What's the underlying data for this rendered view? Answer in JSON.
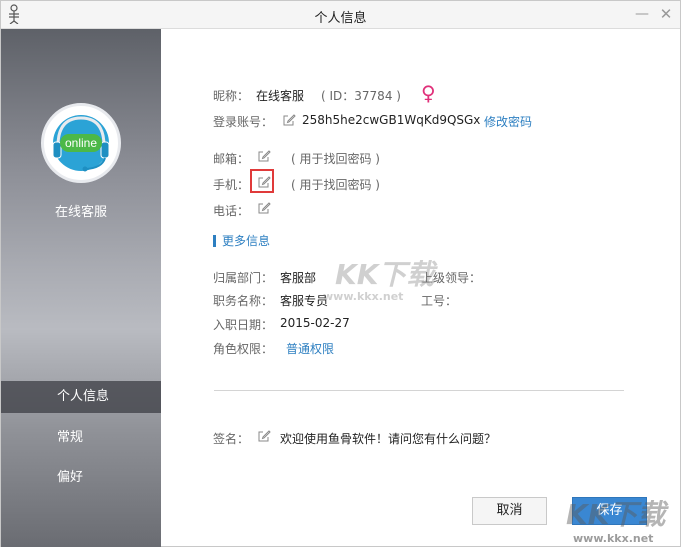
{
  "window": {
    "title": "个人信息"
  },
  "titlebar": {
    "minimize_glyph": "—",
    "close_glyph": "✕"
  },
  "sidebar": {
    "avatar_text": "online",
    "username": "在线客服",
    "items": [
      {
        "label": "个人信息",
        "active": true
      },
      {
        "label": "常规",
        "active": false
      },
      {
        "label": "偏好",
        "active": false
      }
    ]
  },
  "profile": {
    "nickname_label": "昵称：",
    "nickname_value": "在线客服",
    "id_text": "( ID：37784 )",
    "gender_icon": "female-symbol-icon",
    "gender_glyph": "♀",
    "gender_color": "#e0307a",
    "account_label": "登录账号：",
    "account_value": "258h5he2cwGB1WqKd9QSGx",
    "change_password_link": "修改密码",
    "email_label": "邮箱：",
    "email_hint": "( 用于找回密码 )",
    "phone_label": "手机：",
    "phone_hint": "( 用于找回密码 )",
    "tel_label": "电话："
  },
  "more": {
    "section_title": "更多信息",
    "department_label": "归属部门：",
    "department_value": "客服部",
    "superior_label": "上级领导：",
    "position_label": "职务名称：",
    "position_value": "客服专员",
    "job_no_label": "工号：",
    "hire_date_label": "入职日期：",
    "hire_date_value": "2015-02-27",
    "role_label": "角色权限：",
    "role_link": "普通权限"
  },
  "signature": {
    "label": "签名：",
    "value": "欢迎使用鱼骨软件！请问您有什么问题？"
  },
  "buttons": {
    "cancel": "取消",
    "save": "保存"
  },
  "watermarks": {
    "center_text": "KK下载",
    "center_url": "www.kkx.net",
    "corner_text": "KK下载",
    "corner_url": "www.kkx.net"
  },
  "colors": {
    "accent": "#2d7fc1",
    "highlight_border": "#e03a3a",
    "save_button": "#3a87d2"
  }
}
